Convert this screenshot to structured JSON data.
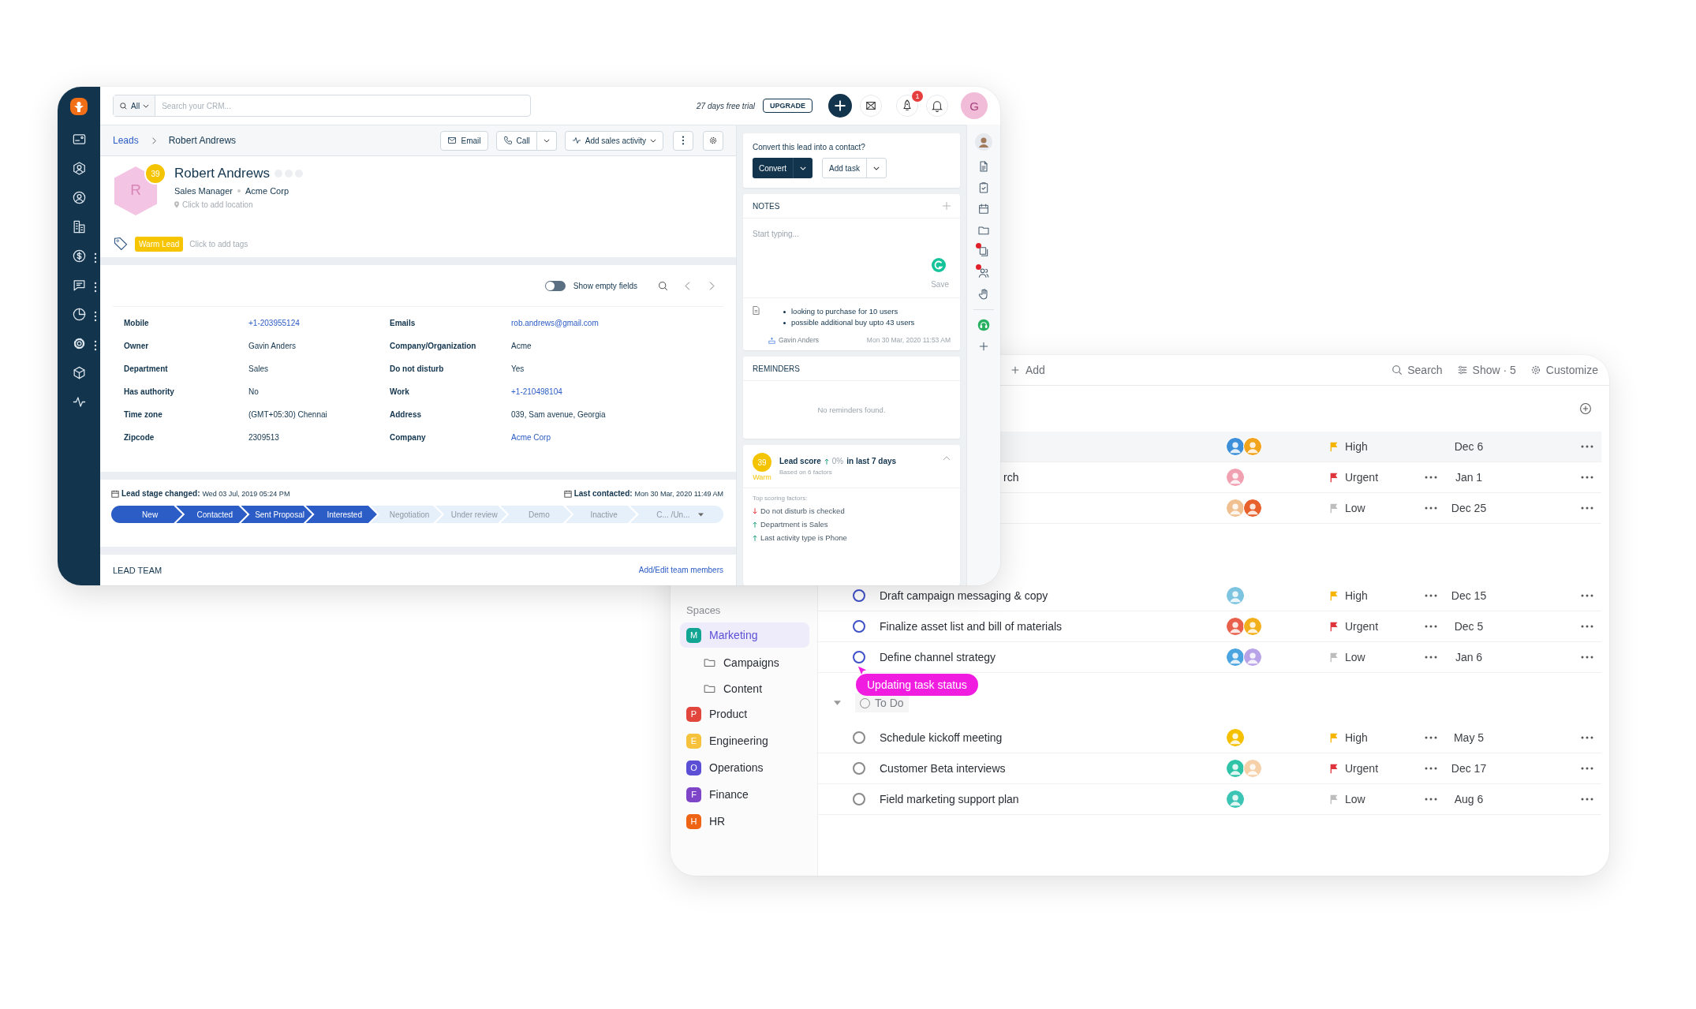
{
  "crm": {
    "nav_items": [
      {
        "kind": "cards",
        "menu": false
      },
      {
        "kind": "contact",
        "menu": false
      },
      {
        "kind": "user",
        "menu": false
      },
      {
        "kind": "building",
        "menu": false
      },
      {
        "kind": "dollar",
        "menu": true
      },
      {
        "kind": "chat",
        "menu": true
      },
      {
        "kind": "pie",
        "menu": true
      },
      {
        "kind": "gear",
        "menu": true
      },
      {
        "kind": "box",
        "menu": false
      },
      {
        "kind": "pulse",
        "menu": false
      }
    ],
    "search": {
      "scope": "All",
      "placeholder": "Search your CRM..."
    },
    "trial": "27 days free trial",
    "upgrade": "UPGRADE",
    "notification_count": "1",
    "user_initial": "G",
    "breadcrumb": [
      "Leads",
      "Robert Andrews"
    ],
    "actions": [
      {
        "label": "Email",
        "kind": "mail"
      },
      {
        "label": "Call",
        "kind": "phone"
      },
      {
        "label": "Add sales activity",
        "kind": "activity"
      }
    ],
    "lead": {
      "name": "Robert Andrews",
      "initial": "R",
      "score": "39",
      "title": "Sales Manager",
      "company": "Acme Corp",
      "location_placeholder": "Click to add location",
      "tag": "Warm Lead",
      "tag_placeholder": "Click to add tags"
    },
    "show_empty_fields": {
      "label": "Show empty fields",
      "on": false
    },
    "fields": [
      {
        "label": "Mobile",
        "value": "+1-203955124",
        "link": true
      },
      {
        "label": "Emails",
        "value": "rob.andrews@gmail.com",
        "link": true
      },
      {
        "label": "Owner",
        "value": "Gavin Anders",
        "link": false
      },
      {
        "label": "Company/Organization",
        "value": "Acme",
        "link": false
      },
      {
        "label": "Department",
        "value": "Sales",
        "link": false
      },
      {
        "label": "Do not disturb",
        "value": "Yes",
        "link": false
      },
      {
        "label": "Has authority",
        "value": "No",
        "link": false
      },
      {
        "label": "Work",
        "value": "+1-210498104",
        "link": true
      },
      {
        "label": "Time zone",
        "value": "(GMT+05:30) Chennai",
        "link": false
      },
      {
        "label": "Address",
        "value": "039, Sam avenue, Georgia",
        "link": false
      },
      {
        "label": "Zipcode",
        "value": "2309513",
        "link": false
      },
      {
        "label": "Company",
        "value": "Acme Corp",
        "link": true
      }
    ],
    "stage_changed": {
      "label": "Lead stage changed:",
      "value": "Wed 03 Jul, 2019 05:24 PM"
    },
    "last_contacted": {
      "label": "Last contacted:",
      "value": "Mon 30 Mar, 2020 11:49 AM"
    },
    "stages": [
      {
        "label": "New",
        "done": true,
        "dropdown": false
      },
      {
        "label": "Contacted",
        "done": true,
        "dropdown": false
      },
      {
        "label": "Sent Proposal",
        "done": true,
        "dropdown": false
      },
      {
        "label": "Interested",
        "done": true,
        "dropdown": false
      },
      {
        "label": "Negotiation",
        "done": false,
        "dropdown": false
      },
      {
        "label": "Under review",
        "done": false,
        "dropdown": false
      },
      {
        "label": "Demo",
        "done": false,
        "dropdown": false
      },
      {
        "label": "Inactive",
        "done": false,
        "dropdown": false
      },
      {
        "label": "C... /Un...",
        "done": false,
        "dropdown": true
      }
    ],
    "team": {
      "title": "LEAD TEAM",
      "link": "Add/Edit team members"
    },
    "convert": {
      "question": "Convert this lead into a contact?",
      "primary": "Convert",
      "secondary": "Add task"
    },
    "notes": {
      "title": "NOTES",
      "placeholder": "Start typing...",
      "save": "Save",
      "items": [
        "looking to purchase for 10 users",
        "possible additional buy upto 43 users"
      ],
      "author": "Gavin Anders",
      "date": "Mon 30 Mar, 2020 11:53 AM"
    },
    "reminders": {
      "title": "REMINDERS",
      "empty": "No reminders found."
    },
    "lead_score": {
      "score": "39",
      "grade": "Warm",
      "label": "Lead score",
      "change": "0%",
      "period": "in last 7 days",
      "basis": "Based on 6 factors",
      "factors_title": "Top scoring factors:",
      "factors": [
        {
          "text": "Do not disturb is checked",
          "rising": false
        },
        {
          "text": "Department is Sales",
          "rising": true
        },
        {
          "text": "Last activity type is Phone",
          "rising": true
        }
      ]
    },
    "side_tools": [
      {
        "kind": "avatar",
        "alert": false
      },
      {
        "kind": "document",
        "alert": false
      },
      {
        "kind": "checklist",
        "alert": false
      },
      {
        "kind": "calendar",
        "alert": false
      },
      {
        "kind": "folder",
        "alert": false
      },
      {
        "kind": "copy",
        "alert": true
      },
      {
        "kind": "people",
        "alert": true
      },
      {
        "kind": "hand",
        "alert": false
      },
      {
        "kind": "headset",
        "alert": false
      },
      {
        "kind": "plus",
        "alert": false
      }
    ]
  },
  "tasks": {
    "toolbar": {
      "add": "Add",
      "search": "Search",
      "show": "Show · 5",
      "customize": "Customize"
    },
    "spaces_title": "Spaces",
    "spaces": [
      {
        "initial": "M",
        "name": "Marketing",
        "color": "#13a594",
        "selected": true,
        "children": [
          {
            "name": "Campaigns"
          },
          {
            "name": "Content"
          }
        ]
      },
      {
        "initial": "P",
        "name": "Product",
        "color": "#e2453c",
        "selected": false
      },
      {
        "initial": "E",
        "name": "Engineering",
        "color": "#f7c23b",
        "selected": false
      },
      {
        "initial": "O",
        "name": "Operations",
        "color": "#5b4fd6",
        "selected": false
      },
      {
        "initial": "F",
        "name": "Finance",
        "color": "#7e45c8",
        "selected": false
      },
      {
        "initial": "H",
        "name": "HR",
        "color": "#ef6414",
        "selected": false
      }
    ],
    "top_rows": [
      {
        "hovered": true,
        "assignees": [
          {
            "color": "#3c8fd8"
          },
          {
            "color": "#f2a41c"
          }
        ],
        "priority": {
          "label": "High",
          "color": "#f5b400"
        },
        "due": "Dec 6"
      },
      {
        "title": "rch",
        "hovered": false,
        "assignees": [
          {
            "color": "#f0a0b0"
          }
        ],
        "priority": {
          "label": "Urgent",
          "color": "#e0343c"
        },
        "due": "Jan 1"
      },
      {
        "hovered": false,
        "assignees": [
          {
            "color": "#f0c090"
          },
          {
            "color": "#e8602c"
          }
        ],
        "priority": {
          "label": "Low",
          "color": "#bdbdbd"
        },
        "due": "Dec 25"
      }
    ],
    "groups": [
      {
        "color": "#3f51c8",
        "rows": [
          {
            "title": "Draft campaign messaging & copy",
            "hovered": false,
            "assignees": [
              {
                "color": "#7cc4e0"
              }
            ],
            "priority": {
              "label": "High",
              "color": "#f5b400"
            },
            "due": "Dec 15"
          },
          {
            "title": "Finalize asset list and bill of materials",
            "hovered": false,
            "assignees": [
              {
                "color": "#e8604c"
              },
              {
                "color": "#f2b01c"
              }
            ],
            "priority": {
              "label": "Urgent",
              "color": "#e0343c"
            },
            "due": "Dec 5"
          },
          {
            "title": "Define channel strategy",
            "hovered": false,
            "tooltip": "Updating task status",
            "assignees": [
              {
                "color": "#4aa4e0"
              },
              {
                "color": "#b9a3e8"
              }
            ],
            "priority": {
              "label": "Low",
              "color": "#bdbdbd"
            },
            "due": "Jan 6"
          }
        ]
      },
      {
        "name": "To Do",
        "expanded": true,
        "color": "#8a8a8a",
        "rows": [
          {
            "title": "Schedule kickoff meeting",
            "hovered": false,
            "assignees": [
              {
                "color": "#f5c000"
              }
            ],
            "priority": {
              "label": "High",
              "color": "#f5b400"
            },
            "due": "May 5"
          },
          {
            "title": "Customer Beta interviews",
            "hovered": false,
            "assignees": [
              {
                "color": "#2fc4a8"
              },
              {
                "color": "#f5d0a8"
              }
            ],
            "priority": {
              "label": "Urgent",
              "color": "#e0343c"
            },
            "due": "Dec 17"
          },
          {
            "title": "Field marketing support plan",
            "hovered": false,
            "assignees": [
              {
                "color": "#3cc4b4"
              }
            ],
            "priority": {
              "label": "Low",
              "color": "#bdbdbd"
            },
            "due": "Aug 6"
          }
        ]
      }
    ]
  }
}
